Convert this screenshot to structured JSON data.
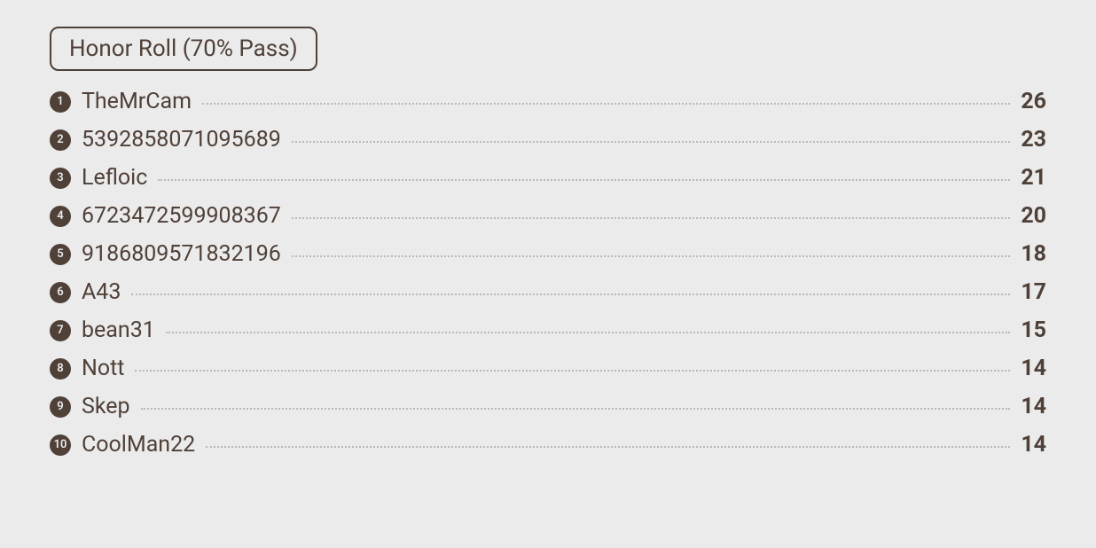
{
  "header": {
    "title": "Honor Roll (70% Pass)"
  },
  "entries": [
    {
      "rank": "1",
      "name": "TheMrCam",
      "score": "26"
    },
    {
      "rank": "2",
      "name": "5392858071095689",
      "score": "23"
    },
    {
      "rank": "3",
      "name": "Lefloic",
      "score": "21"
    },
    {
      "rank": "4",
      "name": "6723472599908367",
      "score": "20"
    },
    {
      "rank": "5",
      "name": "9186809571832196",
      "score": "18"
    },
    {
      "rank": "6",
      "name": "A43",
      "score": "17"
    },
    {
      "rank": "7",
      "name": "bean31",
      "score": "15"
    },
    {
      "rank": "8",
      "name": "Nott",
      "score": "14"
    },
    {
      "rank": "9",
      "name": "Skep",
      "score": "14"
    },
    {
      "rank": "10",
      "name": "CoolMan22",
      "score": "14"
    }
  ]
}
